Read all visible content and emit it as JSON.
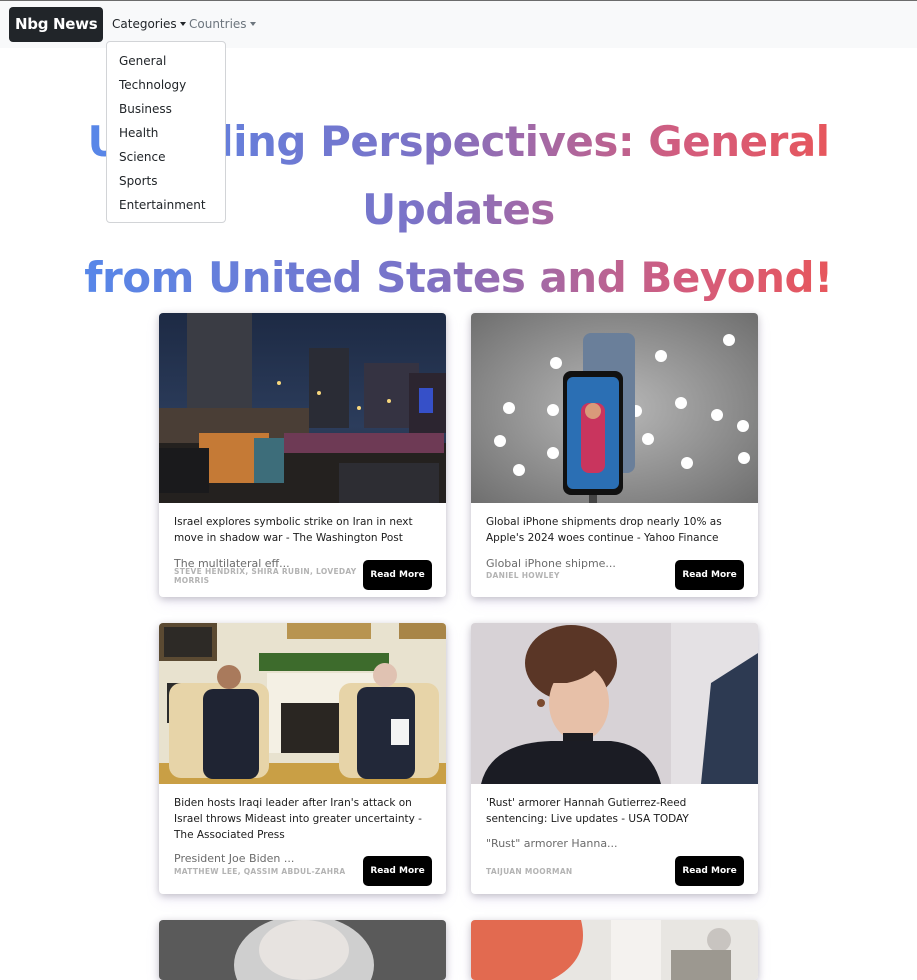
{
  "navbar": {
    "brand": "Nbg News",
    "categories_label": "Categories",
    "countries_label": "Countries"
  },
  "dropdown": {
    "items": [
      "General",
      "Technology",
      "Business",
      "Health",
      "Science",
      "Sports",
      "Entertainment"
    ]
  },
  "hero": {
    "line1": "Unveiling Perspectives: General Updates",
    "line2": "from United States and Beyond!"
  },
  "cards": [
    {
      "title": "Israel explores symbolic strike on Iran in next move in shadow war - The Washington Post",
      "description": "The multilateral eff...",
      "author": "Steve Hendrix, Shira Rubin, Loveday Morris",
      "button": "Read More"
    },
    {
      "title": "Global iPhone shipments drop nearly 10% as Apple's 2024 woes continue - Yahoo Finance",
      "description": "Global iPhone shipme...",
      "author": "Daniel Howley",
      "button": "Read More"
    },
    {
      "title": "Biden hosts Iraqi leader after Iran's attack on Israel throws Mideast into greater uncertainty - The Associated Press",
      "description": "President Joe Biden ...",
      "author": "Matthew Lee, Qassim Abdul-Zahra",
      "button": "Read More"
    },
    {
      "title": "'Rust' armorer Hannah Gutierrez-Reed sentencing: Live updates - USA TODAY",
      "description": "\"Rust\" armorer Hanna...",
      "author": "Taijuan Moorman",
      "button": "Read More"
    }
  ]
}
